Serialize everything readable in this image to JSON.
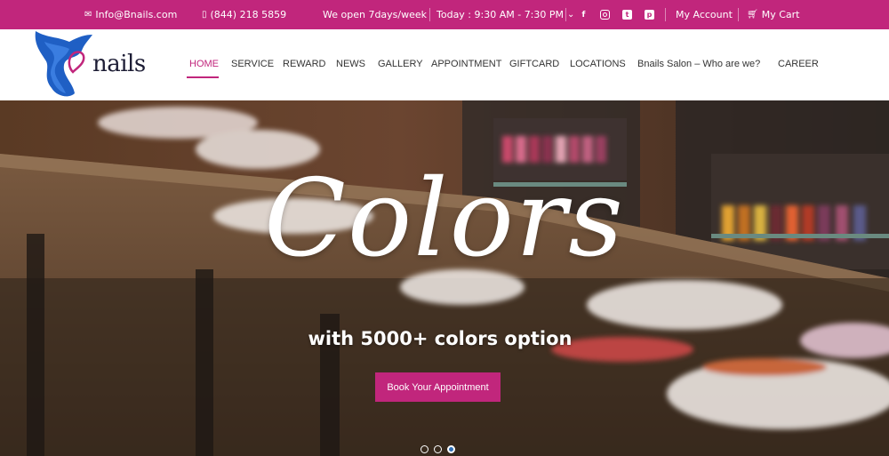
{
  "topbar": {
    "email": "Info@Bnails.com",
    "phone": "(844) 218 5859",
    "open_days": "We open 7days/week",
    "hours": "Today : 9:30 AM - 7:30 PM",
    "my_account": "My Account",
    "my_cart": "My Cart",
    "social": [
      "facebook",
      "instagram",
      "twitter",
      "pinterest"
    ]
  },
  "brand": {
    "name": "nails",
    "accent": "#c1267c",
    "logo_blue": "#1f5fc4"
  },
  "nav": {
    "items": [
      "HOME",
      "SERVICE",
      "REWARD",
      "NEWS",
      "GALLERY",
      "APPOINTMENT",
      "GIFTCARD",
      "LOCATIONS",
      "Bnails Salon – Who are we?",
      "CAREER"
    ],
    "active": "HOME"
  },
  "hero": {
    "title": "Colors",
    "subtitle": "with 5000+ colors option",
    "cta": "Book Your Appointment",
    "slides_total": 3,
    "active_slide": 3
  }
}
